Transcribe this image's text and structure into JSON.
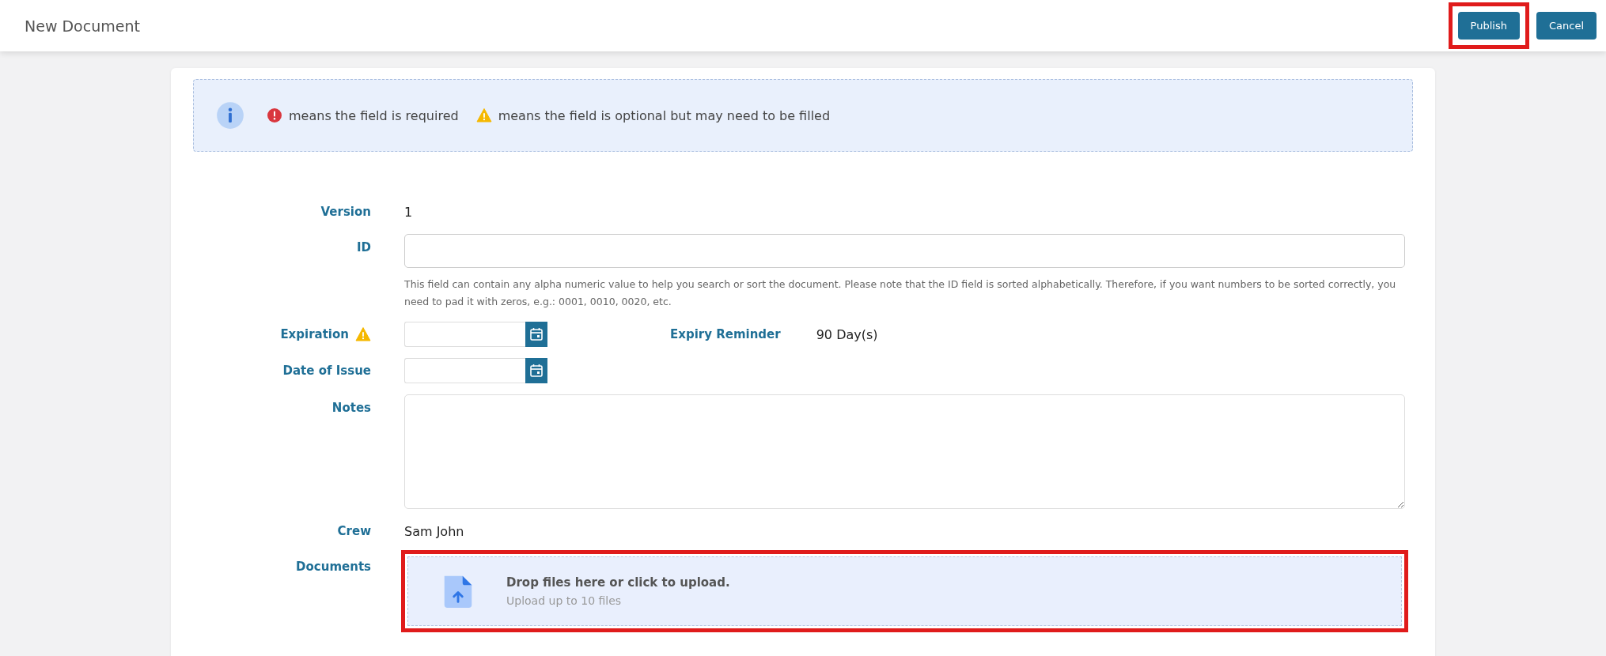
{
  "header": {
    "title": "New Document",
    "buttons": [
      {
        "label": "Publish",
        "highlighted": true
      },
      {
        "label": "Cancel",
        "highlighted": false
      }
    ]
  },
  "legend": {
    "required_text": "means the field is required",
    "optional_text": "means the field is optional but may need to be filled"
  },
  "rows": [
    {
      "kind": "text",
      "label": "Version",
      "value": "1"
    },
    {
      "kind": "input",
      "label": "ID",
      "help": "This field can contain any alpha numeric value to help you search or sort the document. Please note that the ID field is sorted alphabetically. Therefore, if you want numbers to be sorted correctly, you need to pad it with zeros, e.g.: 0001, 0010, 0020, etc."
    },
    {
      "kind": "date",
      "label": "Expiration",
      "warning": true,
      "side_label": "Expiry Reminder",
      "side_value": "90 Day(s)"
    },
    {
      "kind": "date",
      "label": "Date of Issue",
      "warning": false
    },
    {
      "kind": "textarea",
      "label": "Notes"
    },
    {
      "kind": "text",
      "label": "Crew",
      "value": "Sam John"
    },
    {
      "kind": "upload",
      "label": "Documents",
      "title": "Drop files here or click to upload.",
      "subtitle": "Upload up to 10 files",
      "highlighted": true
    }
  ]
}
